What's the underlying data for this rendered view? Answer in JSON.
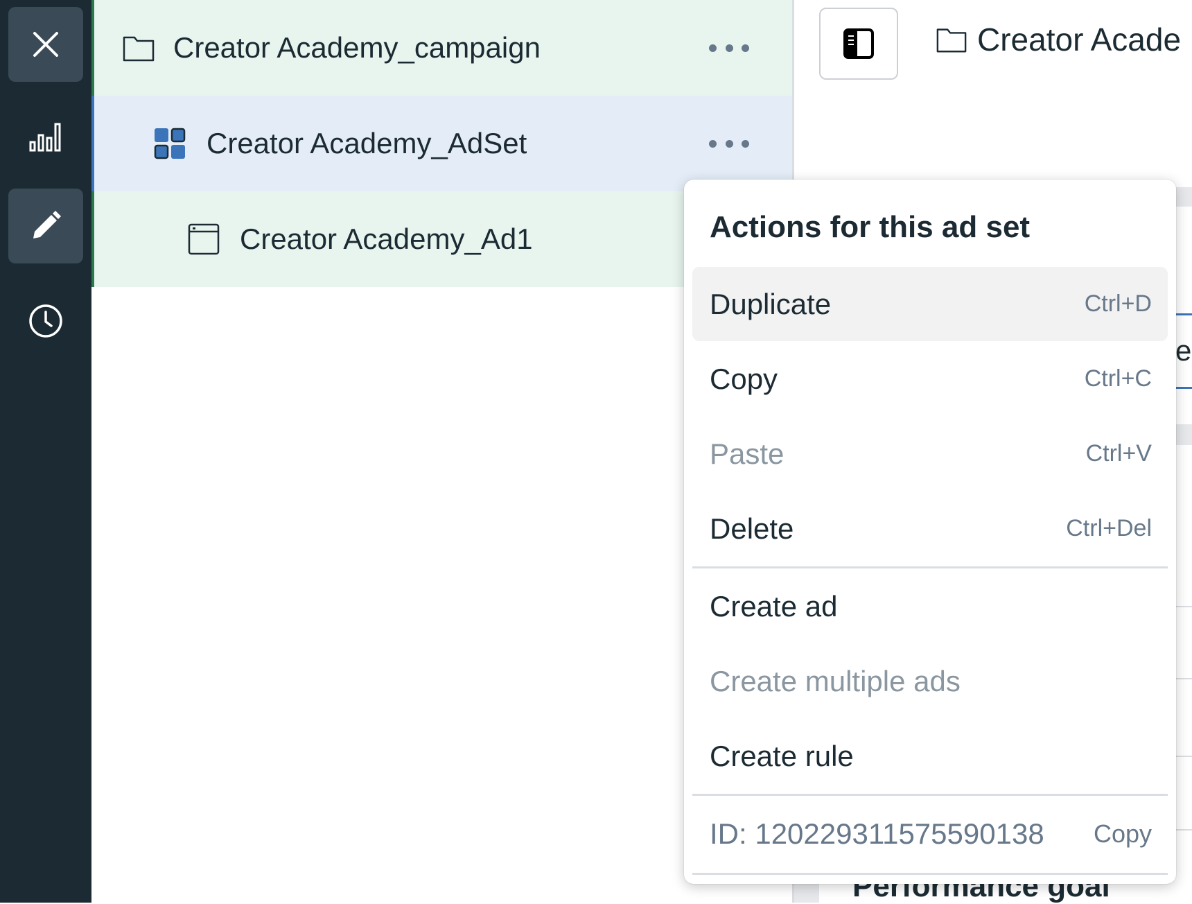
{
  "rail": {
    "items": [
      {
        "name": "close",
        "icon": "close-icon"
      },
      {
        "name": "reporting",
        "icon": "bar-chart-icon"
      },
      {
        "name": "edit",
        "icon": "pencil-icon",
        "active": true
      },
      {
        "name": "history",
        "icon": "clock-icon"
      }
    ]
  },
  "tree": {
    "campaign": {
      "label": "Creator Academy_campaign",
      "icon": "folder-icon"
    },
    "adset": {
      "label": "Creator Academy_AdSet",
      "icon": "adset-grid-icon"
    },
    "ad": {
      "label": "Creator Academy_Ad1",
      "icon": "ad-window-icon"
    }
  },
  "right_panel": {
    "breadcrumb_text": "Creator Acade",
    "background_title": "Performance goal",
    "background_letter": "e"
  },
  "menu": {
    "title": "Actions for this ad set",
    "items": [
      {
        "label": "Duplicate",
        "shortcut": "Ctrl+D",
        "disabled": false
      },
      {
        "label": "Copy",
        "shortcut": "Ctrl+C",
        "disabled": false
      },
      {
        "label": "Paste",
        "shortcut": "Ctrl+V",
        "disabled": true
      },
      {
        "label": "Delete",
        "shortcut": "Ctrl+Del",
        "disabled": false
      },
      {
        "label": "Create ad",
        "shortcut": "",
        "disabled": false
      },
      {
        "label": "Create multiple ads",
        "shortcut": "",
        "disabled": true
      },
      {
        "label": "Create rule",
        "shortcut": "",
        "disabled": false
      }
    ],
    "id_text": "ID: 120229311575590138",
    "id_copy_label": "Copy"
  },
  "colors": {
    "rail_bg": "#1c2b33",
    "campaign_row_bg": "#e8f5ef",
    "adset_row_bg": "#e4edf7",
    "accent_blue": "#3b74b8",
    "disabled_text": "#8a96a0"
  }
}
